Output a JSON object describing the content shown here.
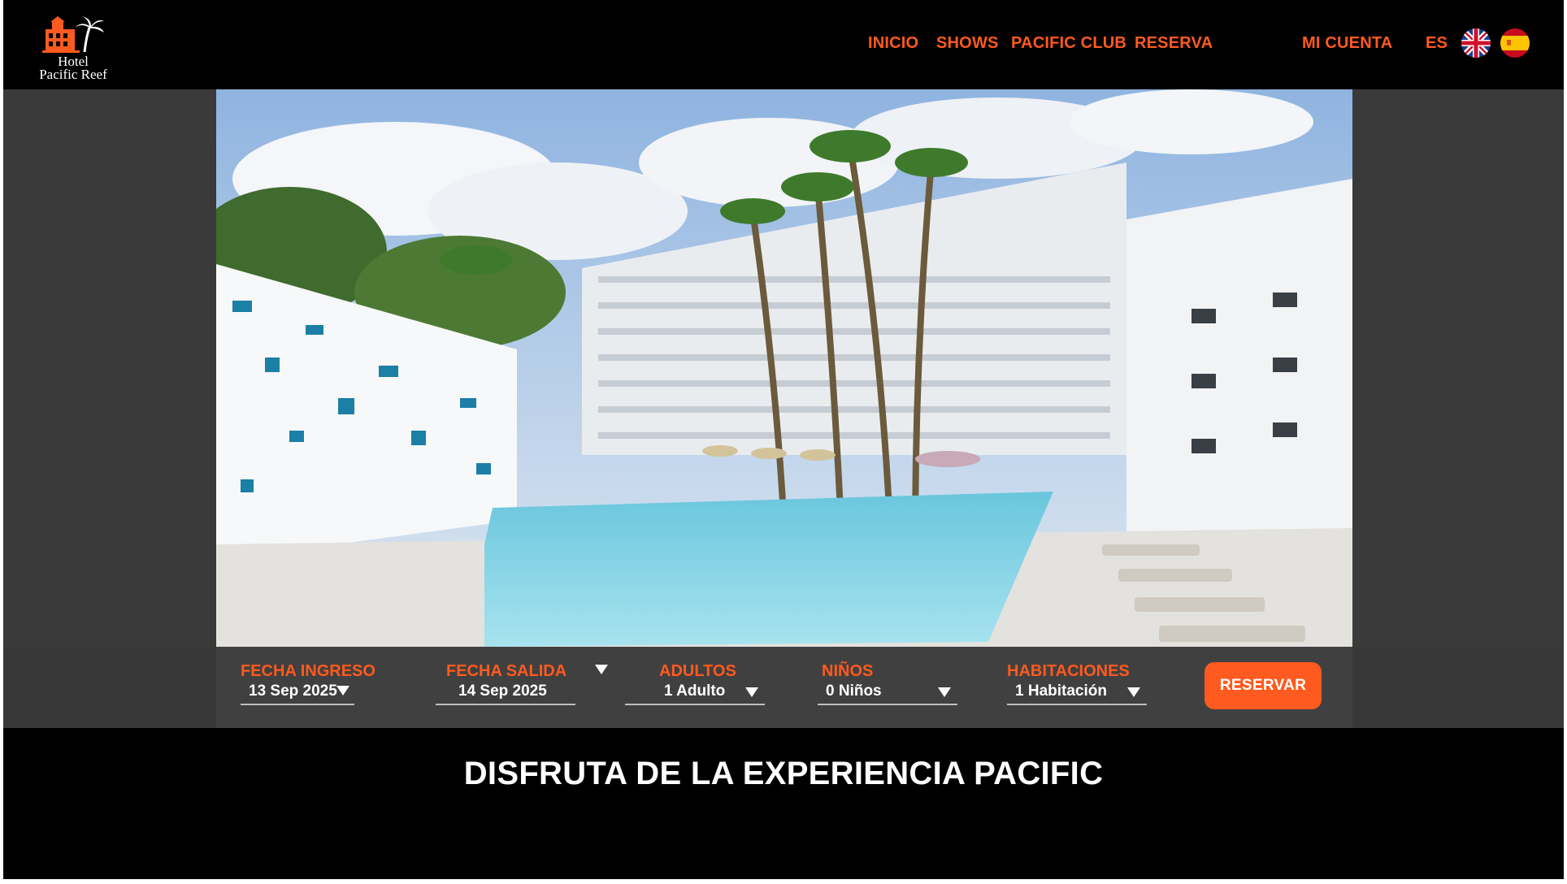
{
  "brand": {
    "line1": "Hotel",
    "line2": "Pacific Reef"
  },
  "nav": {
    "items": [
      {
        "label": "INICIO"
      },
      {
        "label": "SHOWS"
      },
      {
        "label": "PACIFIC CLUB"
      },
      {
        "label": "RESERVA"
      }
    ],
    "account_label": "MI CUENTA",
    "language": "ES",
    "flags": [
      "uk-flag-icon",
      "spain-flag-icon"
    ]
  },
  "hero": {
    "image": "hotel-pool-photo"
  },
  "booking": {
    "checkin": {
      "label": "FECHA INGRESO",
      "value": "13 Sep 2025"
    },
    "checkout": {
      "label": "FECHA SALIDA",
      "value": "14 Sep 2025"
    },
    "adults": {
      "label": "ADULTOS",
      "value": "1 Adulto"
    },
    "children": {
      "label": "NIÑOS",
      "value": "0 Niños"
    },
    "rooms": {
      "label": "HABITACIONES",
      "value": "1 Habitación"
    },
    "submit_label": "RESERVAR"
  },
  "headline": "DISFRUTA DE LA EXPERIENCIA PACIFIC",
  "colors": {
    "accent": "#ff5a1f",
    "background": "#000000",
    "band": "#3a3a3a"
  }
}
